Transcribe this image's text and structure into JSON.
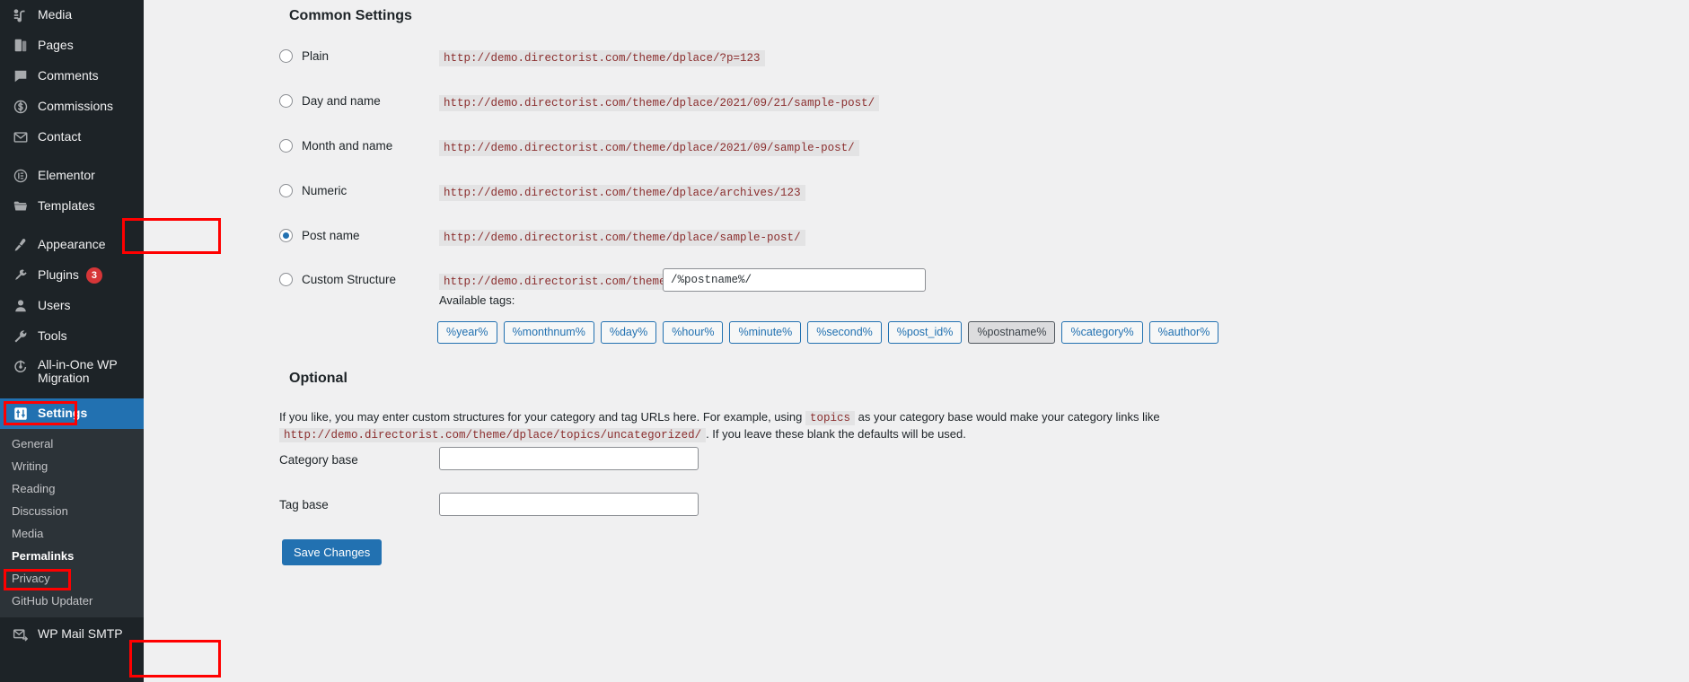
{
  "sidebar": {
    "items": [
      {
        "label": "Media",
        "icon": "media-icon",
        "badge": null
      },
      {
        "label": "Pages",
        "icon": "pages-icon",
        "badge": null
      },
      {
        "label": "Comments",
        "icon": "comments-icon",
        "badge": null
      },
      {
        "label": "Commissions",
        "icon": "commissions-icon",
        "badge": null
      },
      {
        "label": "Contact",
        "icon": "contact-icon",
        "badge": null
      },
      {
        "label": "Elementor",
        "icon": "elementor-icon",
        "badge": null
      },
      {
        "label": "Templates",
        "icon": "templates-icon",
        "badge": null
      },
      {
        "label": "Appearance",
        "icon": "appearance-icon",
        "badge": null
      },
      {
        "label": "Plugins",
        "icon": "plugins-icon",
        "badge": "3"
      },
      {
        "label": "Users",
        "icon": "users-icon",
        "badge": null
      },
      {
        "label": "Tools",
        "icon": "tools-icon",
        "badge": null
      },
      {
        "label": "All-in-One WP\nMigration",
        "icon": "migration-icon",
        "badge": null
      },
      {
        "label": "Settings",
        "icon": "settings-icon",
        "badge": null
      },
      {
        "label": "WP Mail SMTP",
        "icon": "mail-icon",
        "badge": null
      }
    ],
    "submenu": [
      {
        "label": "General"
      },
      {
        "label": "Writing"
      },
      {
        "label": "Reading"
      },
      {
        "label": "Discussion"
      },
      {
        "label": "Media"
      },
      {
        "label": "Permalinks"
      },
      {
        "label": "Privacy"
      },
      {
        "label": "GitHub Updater"
      }
    ],
    "current_item": "Settings",
    "current_submenu": "Permalinks"
  },
  "main": {
    "common_settings_title": "Common Settings",
    "optional_title": "Optional",
    "permalink_options": [
      {
        "label": "Plain",
        "url": "http://demo.directorist.com/theme/dplace/?p=123",
        "selected": false
      },
      {
        "label": "Day and name",
        "url": "http://demo.directorist.com/theme/dplace/2021/09/21/sample-post/",
        "selected": false
      },
      {
        "label": "Month and name",
        "url": "http://demo.directorist.com/theme/dplace/2021/09/sample-post/",
        "selected": false
      },
      {
        "label": "Numeric",
        "url": "http://demo.directorist.com/theme/dplace/archives/123",
        "selected": false
      },
      {
        "label": "Post name",
        "url": "http://demo.directorist.com/theme/dplace/sample-post/",
        "selected": true
      },
      {
        "label": "Custom Structure",
        "url": "http://demo.directorist.com/theme/dplace",
        "selected": false
      }
    ],
    "custom_structure_value": "/%postname%/",
    "available_tags_label": "Available tags:",
    "available_tags": [
      {
        "label": "%year%",
        "active": false
      },
      {
        "label": "%monthnum%",
        "active": false
      },
      {
        "label": "%day%",
        "active": false
      },
      {
        "label": "%hour%",
        "active": false
      },
      {
        "label": "%minute%",
        "active": false
      },
      {
        "label": "%second%",
        "active": false
      },
      {
        "label": "%post_id%",
        "active": false
      },
      {
        "label": "%postname%",
        "active": true
      },
      {
        "label": "%category%",
        "active": false
      },
      {
        "label": "%author%",
        "active": false
      }
    ],
    "optional_desc": {
      "part1": "If you like, you may enter custom structures for your category and tag URLs here. For example, using",
      "code1": "topics",
      "part2": "as your category base would make your category links like",
      "code2": "http://demo.directorist.com/theme/dplace/topics/uncategorized/",
      "part3": ". If you leave these blank the defaults will be used."
    },
    "category_base_label": "Category base",
    "category_base_value": "",
    "tag_base_label": "Tag base",
    "tag_base_value": "",
    "save_label": "Save Changes"
  },
  "colors": {
    "accent": "#2271b1",
    "sidebar_bg": "#1d2327",
    "submenu_bg": "#2c3338",
    "annotation": "#ff0000",
    "badge": "#d63638",
    "code_text": "#8b2e2e"
  }
}
